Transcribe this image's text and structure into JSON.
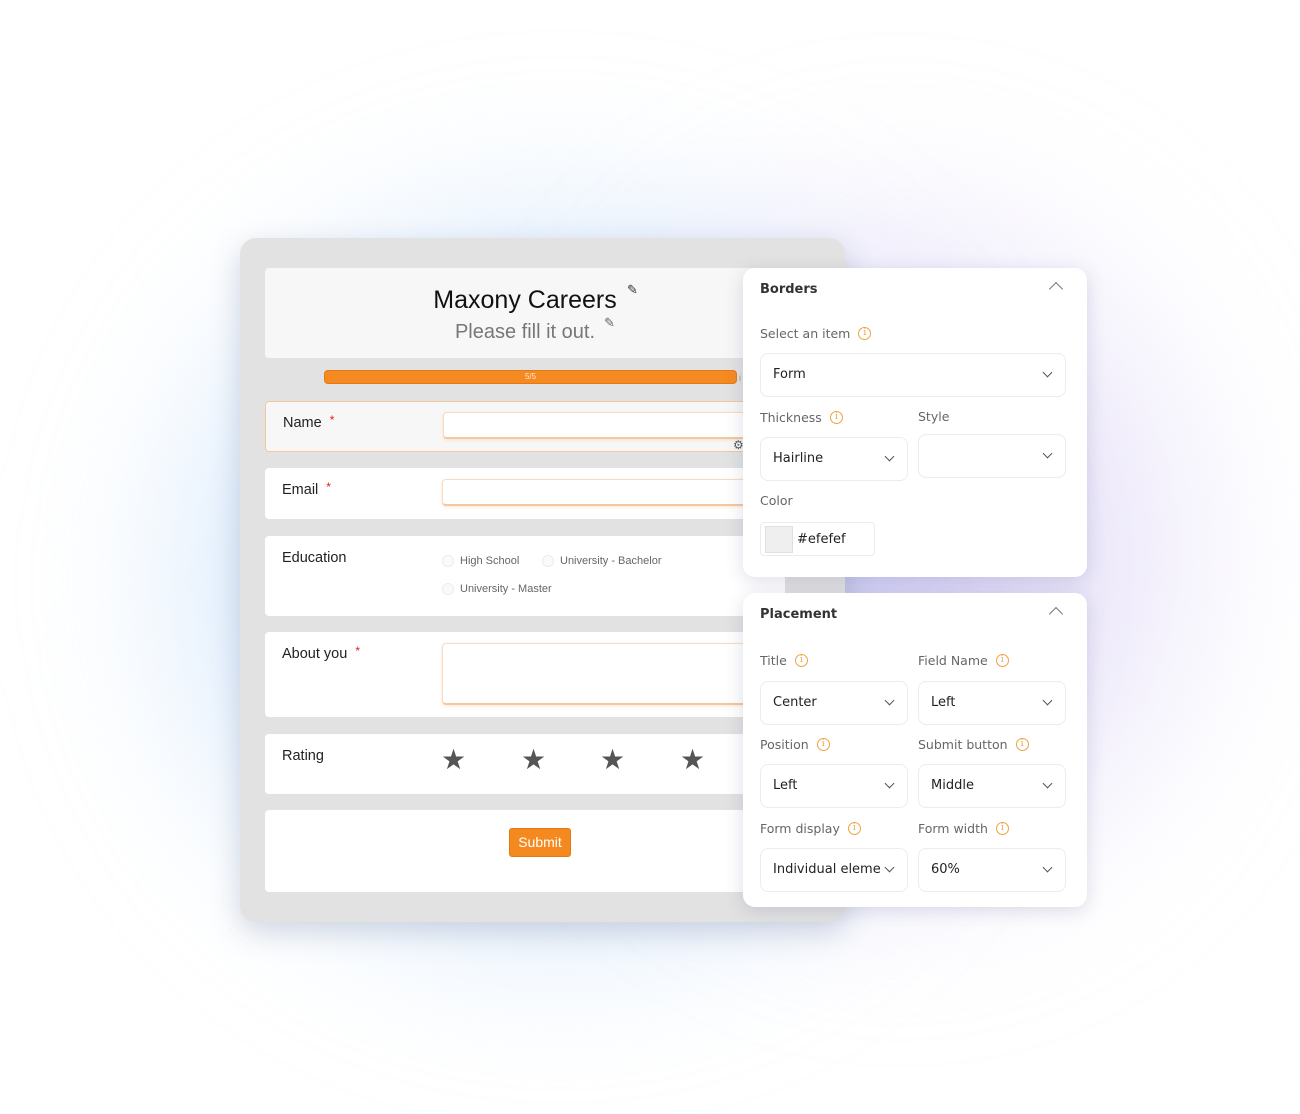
{
  "form": {
    "title": "Maxony Careers",
    "subtitle": "Please fill it out.",
    "progress": {
      "label": "5/5",
      "fraction": 1.0,
      "end_marker": "i"
    },
    "accent_color": "#f48a1f",
    "required_marker": "*",
    "fields": {
      "name": {
        "label": "Name",
        "required": true,
        "value": ""
      },
      "email": {
        "label": "Email",
        "required": true,
        "value": ""
      },
      "education": {
        "label": "Education",
        "options": [
          "High School",
          "University - Bachelor",
          "University - Master"
        ]
      },
      "about": {
        "label": "About you",
        "required": true,
        "value": ""
      },
      "rating": {
        "label": "Rating",
        "stars_visible": 4
      }
    },
    "submit_label": "Submit"
  },
  "borders_panel": {
    "title": "Borders",
    "select_item": {
      "label": "Select an item",
      "value": "Form"
    },
    "thickness": {
      "label": "Thickness",
      "value": "Hairline"
    },
    "style": {
      "label": "Style",
      "value": ""
    },
    "color": {
      "label": "Color",
      "value": "#efefef"
    }
  },
  "placement_panel": {
    "title": "Placement",
    "title_field": {
      "label": "Title",
      "value": "Center"
    },
    "field_name": {
      "label": "Field Name",
      "value": "Left"
    },
    "position": {
      "label": "Position",
      "value": "Left"
    },
    "submit_button": {
      "label": "Submit button",
      "value": "Middle"
    },
    "form_display": {
      "label": "Form display",
      "value": "Individual eleme"
    },
    "form_width": {
      "label": "Form width",
      "value": "60%"
    }
  },
  "icons": {
    "pencil": "✎",
    "gear": "⚙",
    "star": "★",
    "info": "i"
  }
}
